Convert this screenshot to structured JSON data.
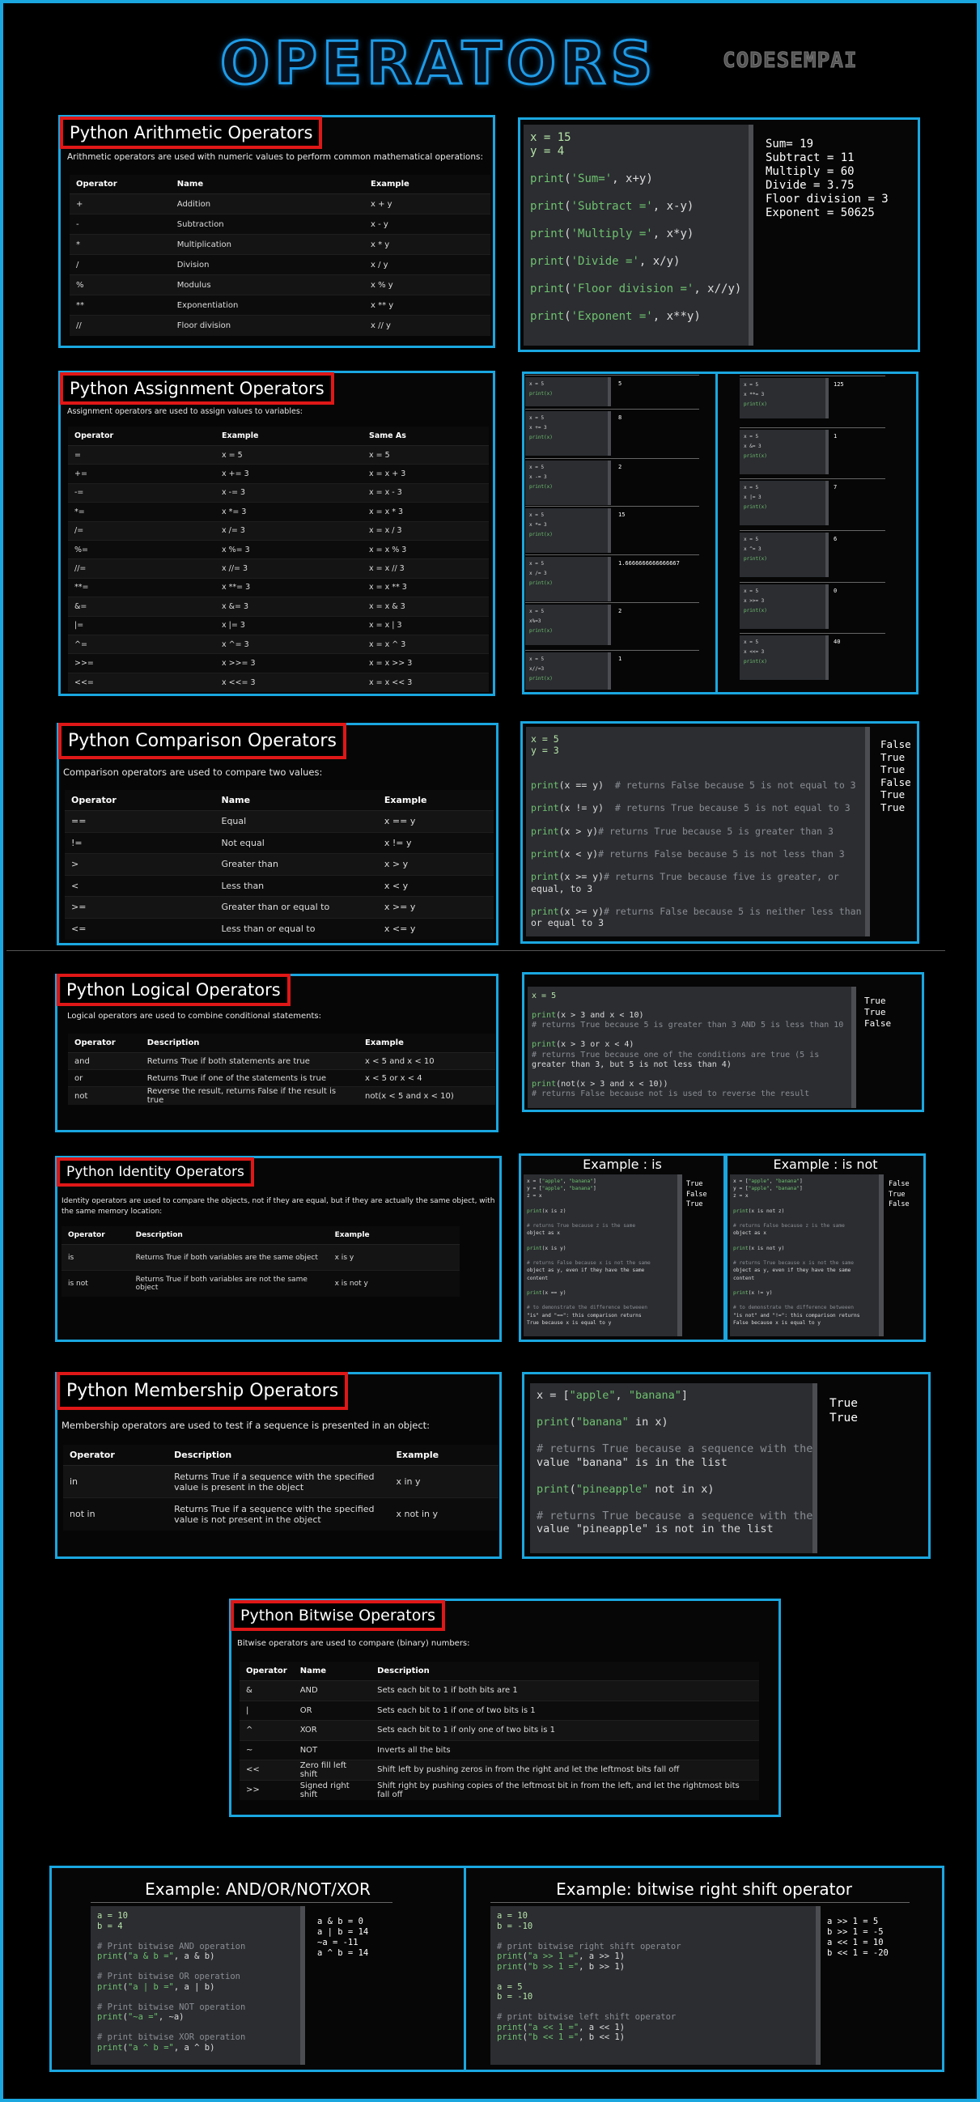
{
  "header": {
    "title": "OPERATORS",
    "brand": "CODESEMPAI"
  },
  "arith": {
    "title": "Python Arithmetic Operators",
    "desc": "Arithmetic operators are used with numeric values to perform common mathematical operations:",
    "cols": [
      "Operator",
      "Name",
      "Example"
    ],
    "rows": [
      [
        "+",
        "Addition",
        "x + y"
      ],
      [
        "-",
        "Subtraction",
        "x - y"
      ],
      [
        "*",
        "Multiplication",
        "x * y"
      ],
      [
        "/",
        "Division",
        "x / y"
      ],
      [
        "%",
        "Modulus",
        "x % y"
      ],
      [
        "**",
        "Exponentiation",
        "x ** y"
      ],
      [
        "//",
        "Floor division",
        "x // y"
      ]
    ],
    "code": [
      "x = 15",
      "y = 4",
      "",
      "print('Sum=', x+y)",
      "",
      "print('Subtract =', x-y)",
      "",
      "print('Multiply =', x*y)",
      "",
      "print('Divide =', x/y)",
      "",
      "print('Floor division =', x//y)",
      "",
      "print('Exponent =', x**y)"
    ],
    "output": [
      "Sum= 19",
      "Subtract = 11",
      "Multiply = 60",
      "Divide = 3.75",
      "Floor division = 3",
      "Exponent = 50625"
    ]
  },
  "assign": {
    "title": "Python Assignment Operators",
    "desc": "Assignment operators are used to assign values to variables:",
    "cols": [
      "Operator",
      "Example",
      "Same As"
    ],
    "rows": [
      [
        "=",
        "x = 5",
        "x = 5"
      ],
      [
        "+=",
        "x += 3",
        "x = x + 3"
      ],
      [
        "-=",
        "x -= 3",
        "x = x - 3"
      ],
      [
        "*=",
        "x *= 3",
        "x = x * 3"
      ],
      [
        "/=",
        "x /= 3",
        "x = x / 3"
      ],
      [
        "%=",
        "x %= 3",
        "x = x % 3"
      ],
      [
        "//=",
        "x //= 3",
        "x = x // 3"
      ],
      [
        "**=",
        "x **= 3",
        "x = x ** 3"
      ],
      [
        "&=",
        "x &= 3",
        "x = x & 3"
      ],
      [
        "|=",
        "x |= 3",
        "x = x | 3"
      ],
      [
        "^=",
        "x ^= 3",
        "x = x ^ 3"
      ],
      [
        ">>=",
        "x >>= 3",
        "x = x >> 3"
      ],
      [
        "<<=",
        "x <<= 3",
        "x = x << 3"
      ]
    ],
    "examples_left": [
      {
        "code": [
          "x = 5",
          "print(x)"
        ],
        "out": "5"
      },
      {
        "code": [
          "x = 5",
          "x += 3",
          "print(x)"
        ],
        "out": "8"
      },
      {
        "code": [
          "x = 5",
          "x -= 3",
          "print(x)"
        ],
        "out": "2"
      },
      {
        "code": [
          "x = 5",
          "x *= 3",
          "print(x)"
        ],
        "out": "15"
      },
      {
        "code": [
          "x = 5",
          "x /= 3",
          "print(x)"
        ],
        "out": "1.6666666666666667"
      },
      {
        "code": [
          "x = 5",
          "x%=3",
          "print(x)"
        ],
        "out": "2"
      },
      {
        "code": [
          "x = 5",
          "x//=3",
          "print(x)"
        ],
        "out": "1"
      }
    ],
    "examples_right": [
      {
        "code": [
          "x = 5",
          "x **= 3",
          "print(x)"
        ],
        "out": "125"
      },
      {
        "code": [
          "x = 5",
          "x &= 3",
          "print(x)"
        ],
        "out": "1"
      },
      {
        "code": [
          "x = 5",
          "x |= 3",
          "print(x)"
        ],
        "out": "7"
      },
      {
        "code": [
          "x = 5",
          "x ^= 3",
          "print(x)"
        ],
        "out": "6"
      },
      {
        "code": [
          "x = 5",
          "x >>= 3",
          "print(x)"
        ],
        "out": "0"
      },
      {
        "code": [
          "x = 5",
          "x <<= 3",
          "print(x)"
        ],
        "out": "40"
      }
    ]
  },
  "compare": {
    "title": "Python Comparison Operators",
    "desc": "Comparison operators are used to compare two values:",
    "cols": [
      "Operator",
      "Name",
      "Example"
    ],
    "rows": [
      [
        "==",
        "Equal",
        "x == y"
      ],
      [
        "!=",
        "Not equal",
        "x != y"
      ],
      [
        ">",
        "Greater than",
        "x > y"
      ],
      [
        "<",
        "Less than",
        "x < y"
      ],
      [
        ">=",
        "Greater than or equal to",
        "x >= y"
      ],
      [
        "<=",
        "Less than or equal to",
        "x <= y"
      ]
    ],
    "code": [
      "x = 5",
      "y = 3",
      "",
      "",
      "print(x == y)  # returns False because 5 is not equal to 3",
      "",
      "print(x != y)  # returns True because 5 is not equal to 3",
      "",
      "print(x > y)# returns True because 5 is greater than 3",
      "",
      "print(x < y)# returns False because 5 is not less than 3",
      "",
      "print(x >= y)# returns True because five is greater, or",
      "equal, to 3",
      "",
      "print(x >= y)# returns False because 5 is neither less than",
      "or equal to 3"
    ],
    "output": [
      "False",
      "True",
      "True",
      "False",
      "True",
      "True"
    ]
  },
  "logical": {
    "title": "Python Logical Operators",
    "desc": "Logical operators are used to combine conditional statements:",
    "cols": [
      "Operator",
      "Description",
      "Example"
    ],
    "rows": [
      [
        "and",
        "Returns True if both statements are true",
        "x < 5 and  x < 10"
      ],
      [
        "or",
        "Returns True if one of the statements is true",
        "x < 5 or x < 4"
      ],
      [
        "not",
        "Reverse the result, returns False if the result is true",
        "not(x < 5 and x < 10)"
      ]
    ],
    "code": [
      "x = 5",
      "",
      "print(x > 3 and x < 10)",
      "# returns True because 5 is greater than 3 AND 5 is less than 10",
      "",
      "print(x > 3 or x < 4)",
      "# returns True because one of the conditions are true (5 is",
      "greater than 3, but 5 is not less than 4)",
      "",
      "print(not(x > 3 and x < 10))",
      "# returns False because not is used to reverse the result"
    ],
    "output": [
      "True",
      "True",
      "False"
    ]
  },
  "identity": {
    "title": "Python Identity Operators",
    "desc": "Identity operators are used to compare the objects, not if they are equal, but if they are actually the same object, with the same memory location:",
    "cols": [
      "Operator",
      "Description",
      "Example"
    ],
    "rows": [
      [
        "is",
        "Returns True if both variables are the same object",
        "x is y"
      ],
      [
        "is not",
        "Returns True if both variables are not the same object",
        "x is not y"
      ]
    ],
    "ex_is_title": "Example : is",
    "ex_isnot_title": "Example : is not",
    "code_is": [
      "x = [\"apple\", \"banana\"]",
      "y = [\"apple\", \"banana\"]",
      "z = x",
      "",
      "print(x is z)",
      "",
      "# returns True because z is the same",
      "object as x",
      "",
      "print(x is y)",
      "",
      "# returns False because x is not the same",
      "object as y, even if they have the same",
      "content",
      "",
      "print(x == y)",
      "",
      "# to demonstrate the difference betweeen",
      "\"is\" and \"==\": this comparison returns",
      "True because x is equal to y"
    ],
    "out_is": [
      "True",
      "False",
      "True"
    ],
    "code_isnot": [
      "x = [\"apple\", \"banana\"]",
      "y = [\"apple\", \"banana\"]",
      "z = x",
      "",
      "print(x is not z)",
      "",
      "# returns False because z is the same",
      "object as x",
      "",
      "print(x is not y)",
      "",
      "# returns True because x is not the same",
      "object as y, even if they have the same",
      "content",
      "",
      "print(x != y)",
      "",
      "# to demonstrate the difference betweeen",
      "\"is not\" and \"!=\": this comparison returns",
      "False because x is equal to y"
    ],
    "out_isnot": [
      "False",
      "True",
      "False"
    ]
  },
  "member": {
    "title": "Python Membership Operators",
    "desc": "Membership operators are used to test if a sequence is presented in an object:",
    "cols": [
      "Operator",
      "Description",
      "Example"
    ],
    "rows": [
      [
        "in",
        "Returns True if a sequence with the specified value is present in the object",
        "x in y"
      ],
      [
        "not in",
        "Returns True if a sequence with the specified value is not present in the object",
        "x not in y"
      ]
    ],
    "code": [
      "x = [\"apple\", \"banana\"]",
      "",
      "print(\"banana\" in x)",
      "",
      "# returns True because a sequence with the",
      "value \"banana\" is in the list",
      "",
      "print(\"pineapple\" not in x)",
      "",
      "# returns True because a sequence with the",
      "value \"pineapple\" is not in the list"
    ],
    "output": [
      "True",
      "True"
    ]
  },
  "bitwise": {
    "title": "Python Bitwise Operators",
    "desc": "Bitwise operators are used to compare (binary) numbers:",
    "cols": [
      "Operator",
      "Name",
      "Description"
    ],
    "rows": [
      [
        "&",
        "AND",
        "Sets each bit to 1 if both bits are 1"
      ],
      [
        "|",
        "OR",
        "Sets each bit to 1 if one of two bits is 1"
      ],
      [
        "^",
        "XOR",
        "Sets each bit to 1 if only one of two bits is 1"
      ],
      [
        "~",
        "NOT",
        "Inverts all the bits"
      ],
      [
        "<<",
        "Zero fill left shift",
        "Shift left by pushing zeros in from the right and let the leftmost bits fall off"
      ],
      [
        ">>",
        "Signed right shift",
        "Shift right by pushing copies of the leftmost bit in from the left, and let the rightmost bits fall off"
      ]
    ],
    "ex1_title": "Example: AND/OR/NOT/XOR",
    "ex1_code": [
      "a = 10",
      "b = 4",
      "",
      "# Print bitwise AND operation",
      "print(\"a & b =\", a & b)",
      "",
      "# Print bitwise OR operation",
      "print(\"a | b =\", a | b)",
      "",
      "# Print bitwise NOT operation",
      "print(\"~a =\", ~a)",
      "",
      "# print bitwise XOR operation",
      "print(\"a ^ b =\", a ^ b)"
    ],
    "ex1_out": [
      "a & b = 0",
      "a | b = 14",
      "~a = -11",
      "a ^ b = 14"
    ],
    "ex2_title": "Example: bitwise right shift operator",
    "ex2_code": [
      "a = 10",
      "b = -10",
      "",
      "# print bitwise right shift operator",
      "print(\"a >> 1 =\", a >> 1)",
      "print(\"b >> 1 =\", b >> 1)",
      "",
      "a = 5",
      "b = -10",
      "",
      "# print bitwise left shift operator",
      "print(\"a << 1 =\", a << 1)",
      "print(\"b << 1 =\", b << 1)"
    ],
    "ex2_out": [
      "a >> 1 = 5",
      "b >> 1 = -5",
      "a << 1 = 10",
      "b << 1 = -20"
    ]
  }
}
